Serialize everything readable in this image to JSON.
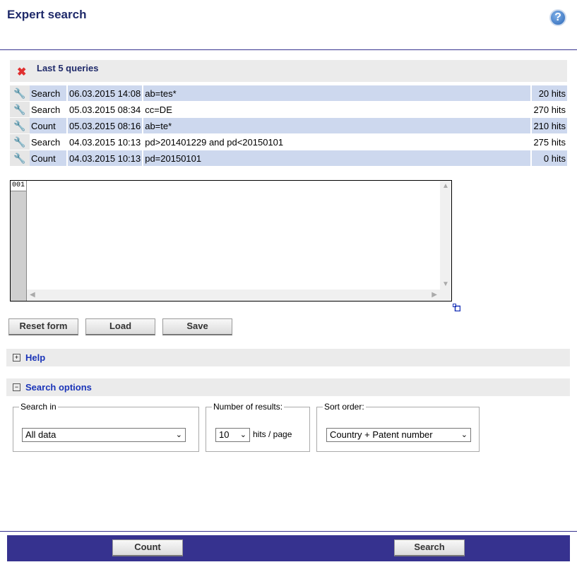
{
  "header": {
    "title": "Expert search",
    "help_icon": "?"
  },
  "history": {
    "title": "Last 5 queries",
    "clear_icon": "✖",
    "rows": [
      {
        "type": "Search",
        "date": "06.03.2015 14:08",
        "query": "ab=tes*",
        "hits": "20 hits"
      },
      {
        "type": "Search",
        "date": "05.03.2015 08:34",
        "query": "cc=DE",
        "hits": "270 hits"
      },
      {
        "type": "Count",
        "date": "05.03.2015 08:16",
        "query": "ab=te*",
        "hits": "210 hits"
      },
      {
        "type": "Search",
        "date": "04.03.2015 10:13",
        "query": "pd>201401229 and pd<20150101",
        "hits": "275 hits"
      },
      {
        "type": "Count",
        "date": "04.03.2015 10:13",
        "query": "pd=20150101",
        "hits": "0 hits"
      }
    ]
  },
  "editor": {
    "line_number": "001",
    "content": ""
  },
  "buttons": {
    "reset": "Reset form",
    "load": "Load",
    "save": "Save"
  },
  "help_section": {
    "toggle": "+",
    "label": "Help"
  },
  "search_options": {
    "toggle": "−",
    "label": "Search options",
    "search_in": {
      "legend": "Search in",
      "value": "All data"
    },
    "num_results": {
      "legend": "Number of results:",
      "value": "10",
      "suffix": "hits / page"
    },
    "sort_order": {
      "legend": "Sort order:",
      "value": "Country + Patent number"
    }
  },
  "footer": {
    "count": "Count",
    "search": "Search"
  }
}
